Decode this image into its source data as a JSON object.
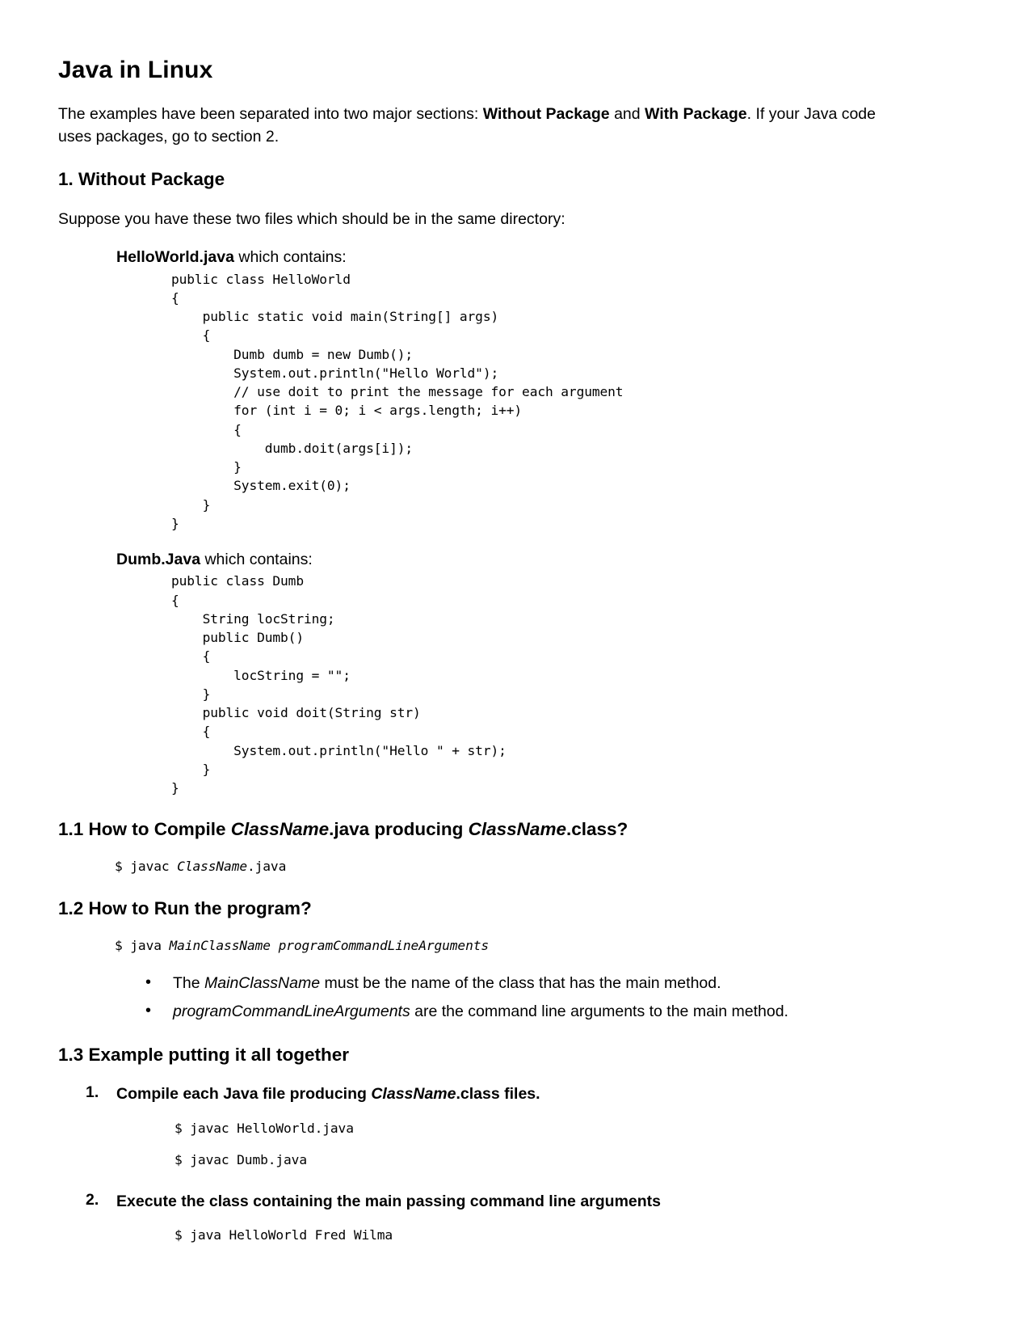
{
  "document": {
    "title": "Java in Linux",
    "intro": {
      "prefix": "The examples have been separated into two major sections:  ",
      "bold1": "Without Package",
      "mid": " and ",
      "bold2": "With Package",
      "suffix": ".  If your Java code uses packages, go to section 2."
    },
    "sections": [
      {
        "heading": "1. Without Package",
        "lead": "Suppose you have these two files which should be in the same directory:",
        "files": [
          {
            "name": "HelloWorld.java",
            "label_suffix": " which contains:",
            "code": "public class HelloWorld\n{\n    public static void main(String[] args)\n    {\n        Dumb dumb = new Dumb();\n        System.out.println(\"Hello World\");\n        // use doit to print the message for each argument\n        for (int i = 0; i < args.length; i++)\n        {\n            dumb.doit(args[i]);\n        }\n        System.exit(0);\n    }\n}"
          },
          {
            "name": "Dumb.Java",
            "label_suffix": " which contains:",
            "code": "public class Dumb\n{\n    String locString;\n    public Dumb()\n    {\n        locString = \"\";\n    }\n    public void doit(String str)\n    {\n        System.out.println(\"Hello \" + str);\n    }\n}"
          }
        ]
      },
      {
        "heading_parts": {
          "p1": "1.1 How to Compile ",
          "italic1": "ClassName",
          "p2": ".java producing ",
          "italic2": "ClassName",
          "p3": ".class?"
        },
        "command": {
          "prefix": "$ javac ",
          "italic": "ClassName",
          "suffix": ".java"
        }
      },
      {
        "heading": "1.2 How to Run the program?",
        "command": {
          "prefix": "$ java ",
          "italic": "MainClassName programCommandLineArguments",
          "suffix": ""
        },
        "bullets": [
          {
            "pre": "The ",
            "italic": "MainClassName",
            "post": " must be the name of the class that has the main method."
          },
          {
            "pre": "",
            "italic": "programCommandLineArguments",
            "post": " are the command line arguments to the main method."
          }
        ]
      },
      {
        "heading": "1.3 Example putting it all together",
        "steps": [
          {
            "number": "1.",
            "text_pre": "Compile each Java file producing ",
            "text_italic": "ClassName",
            "text_post": ".class files.",
            "commands": [
              "$ javac HelloWorld.java",
              "$ javac Dumb.java"
            ]
          },
          {
            "number": "2.",
            "text_pre": "Execute the class containing the main passing command line arguments",
            "text_italic": "",
            "text_post": "",
            "commands": [
              "$ java HelloWorld Fred Wilma"
            ]
          }
        ]
      }
    ]
  }
}
